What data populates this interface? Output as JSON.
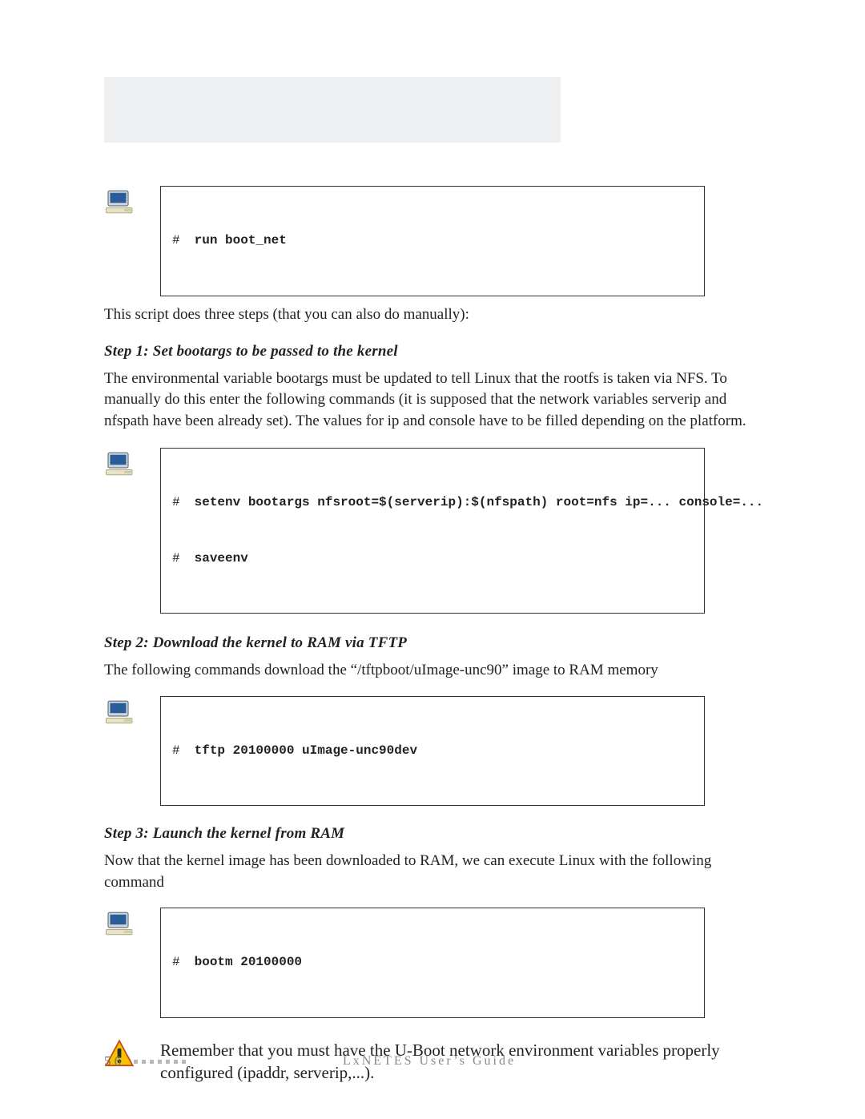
{
  "code1": {
    "line1": {
      "prompt": "#",
      "cmd": "run boot_net"
    }
  },
  "intro_text": "This script does three steps (that you can also do manually):",
  "step1": {
    "heading": "Step 1: Set bootargs to be passed to the kernel",
    "body": "The environmental variable bootargs must be updated to tell Linux that the rootfs is taken via NFS. To manually do this enter the following commands (it is supposed that the network variables serverip and nfspath have been already set). The values for ip and console have to be filled depending on the platform."
  },
  "code2": {
    "line1": {
      "prompt": "#",
      "cmd": "setenv bootargs nfsroot=$(serverip):$(nfspath) root=nfs ip=... console=..."
    },
    "line2": {
      "prompt": "#",
      "cmd": "saveenv"
    }
  },
  "step2": {
    "heading": "Step 2: Download the kernel to RAM via TFTP",
    "body": "The following commands download the “/tftpboot/uImage-unc90” image to RAM memory"
  },
  "code3": {
    "line1": {
      "prompt": "#",
      "cmd": "tftp 20100000 uImage-unc90dev"
    }
  },
  "step3": {
    "heading": "Step 3: Launch the kernel from RAM",
    "body": "Now that the kernel image has been downloaded to RAM, we can execute Linux with the following command"
  },
  "code4": {
    "line1": {
      "prompt": "#",
      "cmd": "bootm 20100000"
    }
  },
  "warning_text": "Remember that you must have the U-Boot network environment variables properly configured (ipaddr, serverip,...).",
  "footer": {
    "page_number": "56",
    "title": "LxNETES User’s Guide"
  }
}
